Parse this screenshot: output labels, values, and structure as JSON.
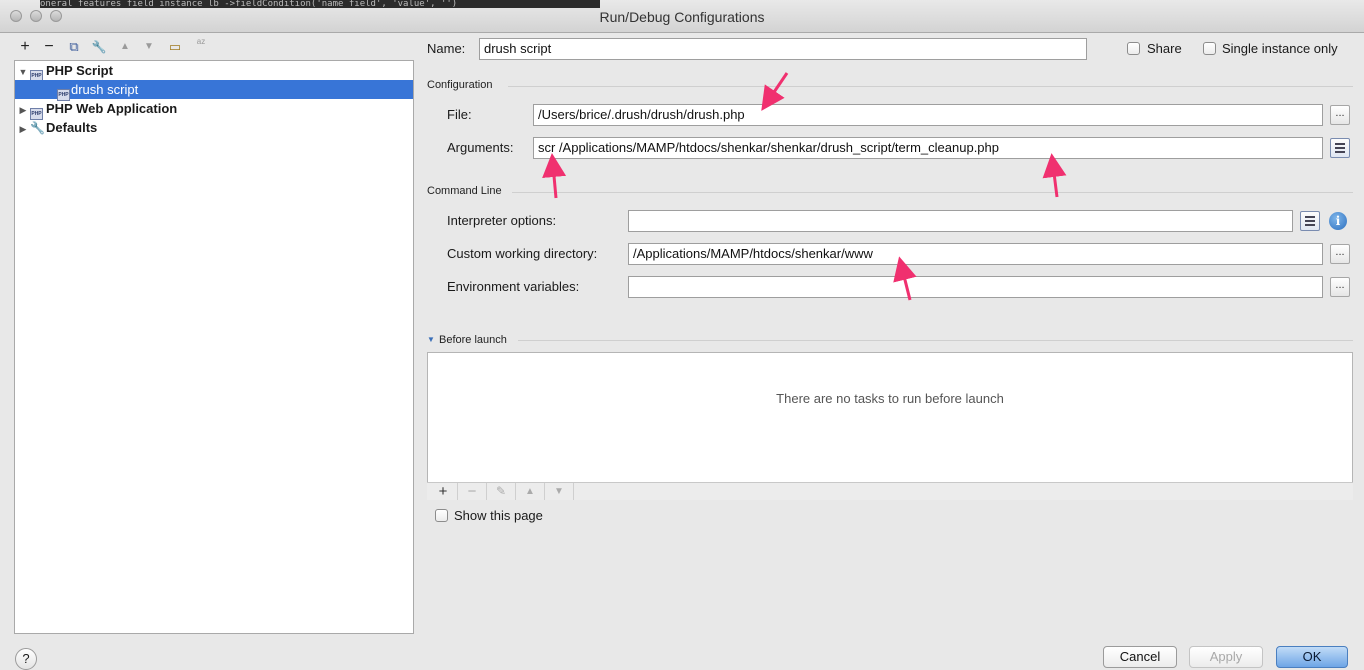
{
  "window": {
    "title": "Run/Debug Configurations",
    "background_code": "oneral features field instance   lb       ->fieldCondition('name field', 'value', '')"
  },
  "left_toolbar": {
    "add": "+",
    "remove": "−",
    "copy": "⧉",
    "edit_defaults": "🔧",
    "move_up": "▲",
    "move_down": "▼",
    "folder": "▭",
    "sort": "az"
  },
  "tree": {
    "items": [
      {
        "label": "PHP Script",
        "arrow": "▼",
        "icon": "php-icon"
      },
      {
        "label": "drush script",
        "icon": "php-icon",
        "selected": true
      },
      {
        "label": "PHP Web Application",
        "arrow": "▶",
        "icon": "php-icon"
      },
      {
        "label": "Defaults",
        "arrow": "▶",
        "icon": "wrench-icon"
      }
    ]
  },
  "form": {
    "name_label": "Name:",
    "name_value": "drush script",
    "share_label": "Share",
    "single_instance_label": "Single instance only",
    "configuration_section": "Configuration",
    "file_label": "File:",
    "file_value": "/Users/brice/.drush/drush/drush.php",
    "arguments_label": "Arguments:",
    "arguments_value": "scr /Applications/MAMP/htdocs/shenkar/shenkar/drush_script/term_cleanup.php",
    "command_line_section": "Command Line",
    "interpreter_label": "Interpreter options:",
    "interpreter_value": "",
    "working_dir_label": "Custom working directory:",
    "working_dir_value": "/Applications/MAMP/htdocs/shenkar/www",
    "env_label": "Environment variables:",
    "env_value": "",
    "dots": "...",
    "info": "i"
  },
  "before_launch": {
    "title": "Before launch",
    "empty_text": "There are no tasks to run before launch",
    "show_page_label": "Show this page",
    "add": "+",
    "remove": "−",
    "edit": "✎",
    "up": "▲",
    "down": "▼"
  },
  "buttons": {
    "help": "?",
    "cancel": "Cancel",
    "apply": "Apply",
    "ok": "OK"
  },
  "colors": {
    "selection": "#3875d7",
    "annotation_arrow": "#f0306f"
  }
}
